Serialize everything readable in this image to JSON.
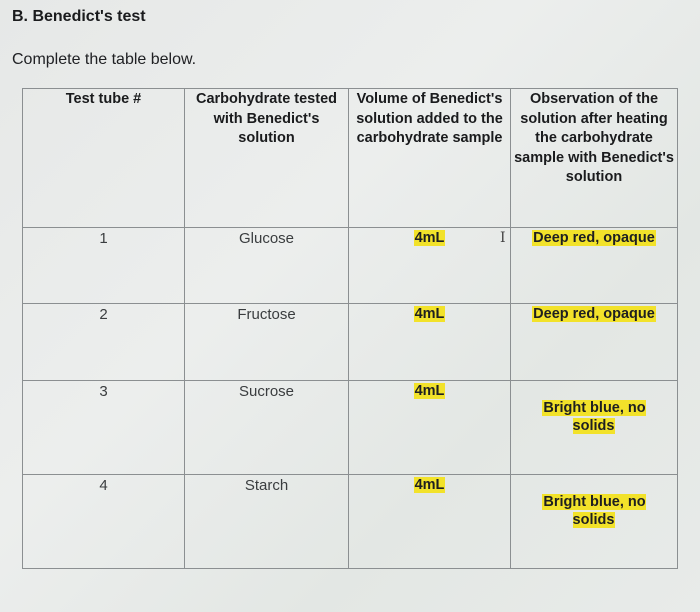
{
  "section_title": "B. Benedict's test",
  "instructions": "Complete the table below.",
  "table": {
    "headers": [
      "Test tube #",
      "Carbohydrate tested with Benedict's solution",
      "Volume of Benedict's solution added to the carbohydrate sample",
      "Observation of the solution after heating the carbohydrate sample with Benedict's solution"
    ],
    "rows": [
      {
        "tube": "1",
        "carbohydrate": "Glucose",
        "volume": "4mL",
        "observation": "Deep red, opaque"
      },
      {
        "tube": "2",
        "carbohydrate": "Fructose",
        "volume": "4mL",
        "observation": "Deep red, opaque"
      },
      {
        "tube": "3",
        "carbohydrate": "Sucrose",
        "volume": "4mL",
        "observation": "Bright blue, no solids"
      },
      {
        "tube": "4",
        "carbohydrate": "Starch",
        "volume": "4mL",
        "observation": "Bright blue, no solids"
      }
    ]
  },
  "colors": {
    "highlight": "#f2e22a",
    "grid": "#8b8f91"
  },
  "icons": {
    "cursor": "text-cursor-icon"
  }
}
